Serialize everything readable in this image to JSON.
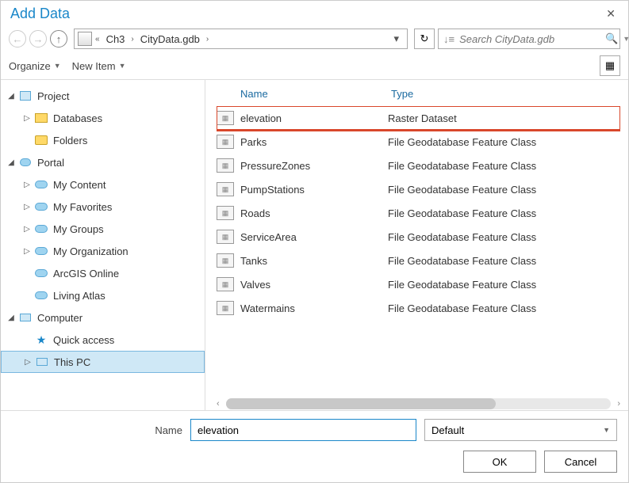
{
  "dialog": {
    "title": "Add Data"
  },
  "path": {
    "segments": [
      "Ch3",
      "CityData.gdb"
    ]
  },
  "search": {
    "placeholder": "Search CityData.gdb"
  },
  "toolbar": {
    "organize": "Organize",
    "new_item": "New Item"
  },
  "tree": {
    "project": "Project",
    "databases": "Databases",
    "folders": "Folders",
    "portal": "Portal",
    "my_content": "My Content",
    "my_favorites": "My Favorites",
    "my_groups": "My Groups",
    "my_org": "My Organization",
    "arcgis_online": "ArcGIS Online",
    "living_atlas": "Living Atlas",
    "computer": "Computer",
    "quick_access": "Quick access",
    "this_pc": "This PC"
  },
  "columns": {
    "name": "Name",
    "type": "Type"
  },
  "items": [
    {
      "name": "elevation",
      "type": "Raster Dataset",
      "highlighted": true
    },
    {
      "name": "Parks",
      "type": "File Geodatabase Feature Class"
    },
    {
      "name": "PressureZones",
      "type": "File Geodatabase Feature Class"
    },
    {
      "name": "PumpStations",
      "type": "File Geodatabase Feature Class"
    },
    {
      "name": "Roads",
      "type": "File Geodatabase Feature Class"
    },
    {
      "name": "ServiceArea",
      "type": "File Geodatabase Feature Class"
    },
    {
      "name": "Tanks",
      "type": "File Geodatabase Feature Class"
    },
    {
      "name": "Valves",
      "type": "File Geodatabase Feature Class"
    },
    {
      "name": "Watermains",
      "type": "File Geodatabase Feature Class"
    }
  ],
  "name_field": {
    "label": "Name",
    "value": "elevation"
  },
  "filter": {
    "value": "Default"
  },
  "buttons": {
    "ok": "OK",
    "cancel": "Cancel"
  }
}
